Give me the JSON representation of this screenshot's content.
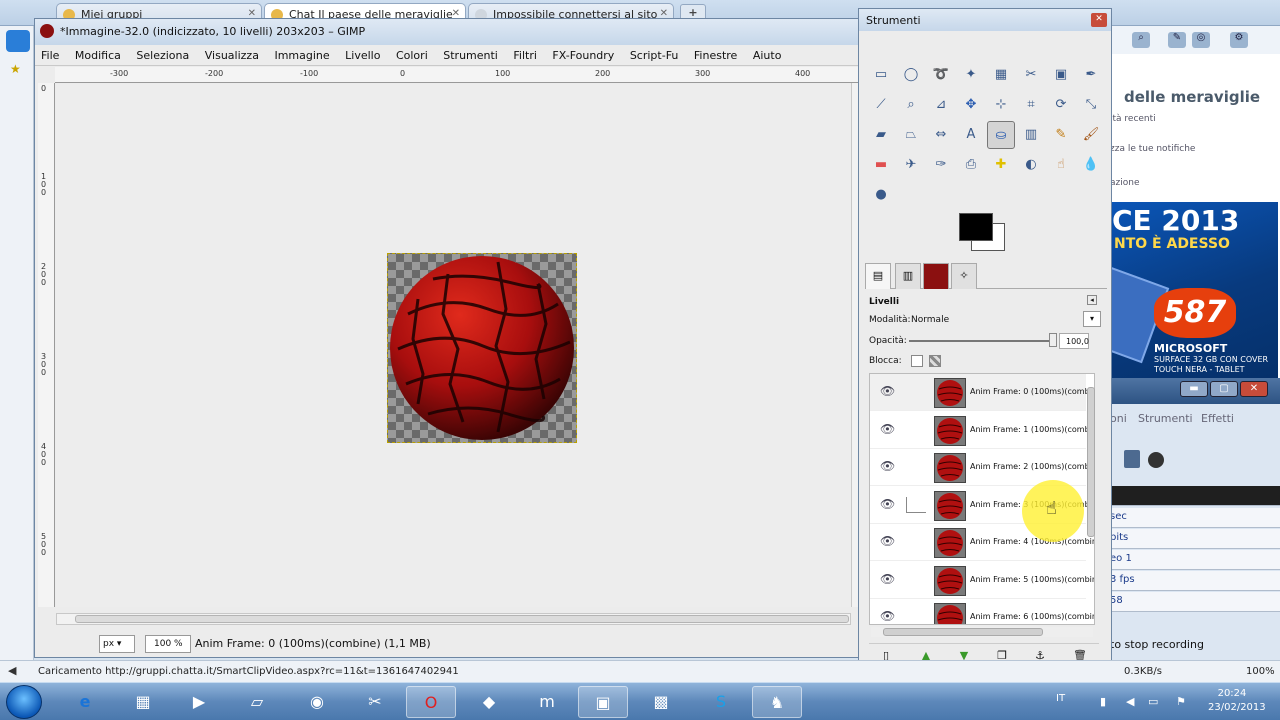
{
  "browser": {
    "tabs": [
      {
        "label": "Miei gruppi"
      },
      {
        "label": "Chat Il paese delle meraviglie"
      },
      {
        "label": "Impossibile connettersi al sito"
      }
    ],
    "new_tab_label": "+",
    "right_panel": {
      "title": "delle meraviglie",
      "line1": "ità recenti",
      "line2": "zza le tue notifiche",
      "line3": "azione"
    },
    "ad": {
      "headline": "CE 2013",
      "subline": "NTO È ADESSO",
      "price": "587",
      "line1": "MICROSOFT",
      "line2": "SURFACE 32 GB CON COVER",
      "line3": "TOUCH NERA - TABLET"
    },
    "recorder": {
      "menu": [
        "oni",
        "Strumenti",
        "Effetti"
      ],
      "rows": [
        "sec",
        "bits",
        "eo 1",
        "3 fps",
        "58"
      ],
      "stop_label": "to stop recording"
    },
    "status_text": "Caricamento http://gruppi.chatta.it/SmartClipVideo.aspx?rc=11&t=1361647402941",
    "speed": "0.3KB/s",
    "zoom": "100%"
  },
  "gimp": {
    "title": "*Immagine-32.0 (indicizzato, 10 livelli) 203x203 – GIMP",
    "menu": [
      "File",
      "Modifica",
      "Seleziona",
      "Visualizza",
      "Immagine",
      "Livello",
      "Colori",
      "Strumenti",
      "Filtri",
      "FX-Foundry",
      "Script-Fu",
      "Finestre",
      "Aiuto"
    ],
    "ruler_top": [
      "-300",
      "-200",
      "-100",
      "0",
      "100",
      "200",
      "300",
      "400"
    ],
    "ruler_left": [
      "0",
      "100",
      "200",
      "300",
      "400",
      "500"
    ],
    "unit": "px",
    "zoom": "100 %",
    "status": "Anim Frame: 0 (100ms)(combine) (1,1 MB)"
  },
  "toolbox": {
    "title": "Strumenti",
    "tools": [
      "rect-select-icon",
      "ellipse-select-icon",
      "lasso-icon",
      "fuzzy-select-icon",
      "color-select-icon",
      "scissors-icon",
      "foreground-select-icon",
      "paths-icon",
      "color-picker-icon",
      "zoom-icon",
      "measure-icon",
      "move-icon",
      "align-icon",
      "crop-icon",
      "rotate-icon",
      "scale-icon",
      "shear-icon",
      "perspective-icon",
      "flip-icon",
      "text-icon",
      "bucket-fill-icon",
      "blend-icon",
      "pencil-icon",
      "paintbrush-icon",
      "eraser-icon",
      "airbrush-icon",
      "ink-icon",
      "clone-icon",
      "heal-icon",
      "dodge-icon",
      "smudge-icon",
      "blur-icon",
      "mypaint-icon"
    ],
    "layers_title": "Livelli",
    "mode_label": "Modalità:",
    "mode_value": "Normale",
    "opacity_label": "Opacità:",
    "opacity_value": "100,0",
    "opacity_fraction": 1.0,
    "lock_label": "Blocca:",
    "layers": [
      "Anim Frame: 0 (100ms)(combine)",
      "Anim Frame: 1 (100ms)(combine)",
      "Anim Frame: 2 (100ms)(combine)",
      "Anim Frame: 3 (100ms)(combine)",
      "Anim Frame: 4 (100ms)(combine)",
      "Anim Frame: 5 (100ms)(combine)",
      "Anim Frame: 6 (100ms)(combine)"
    ]
  },
  "taskbar": {
    "lang": "IT",
    "time": "20:24",
    "date": "23/02/2013"
  },
  "colors": {
    "accent": "#2a7ed8",
    "sphere": "#b01010",
    "foreground": "#000000",
    "background": "#ffffff"
  }
}
